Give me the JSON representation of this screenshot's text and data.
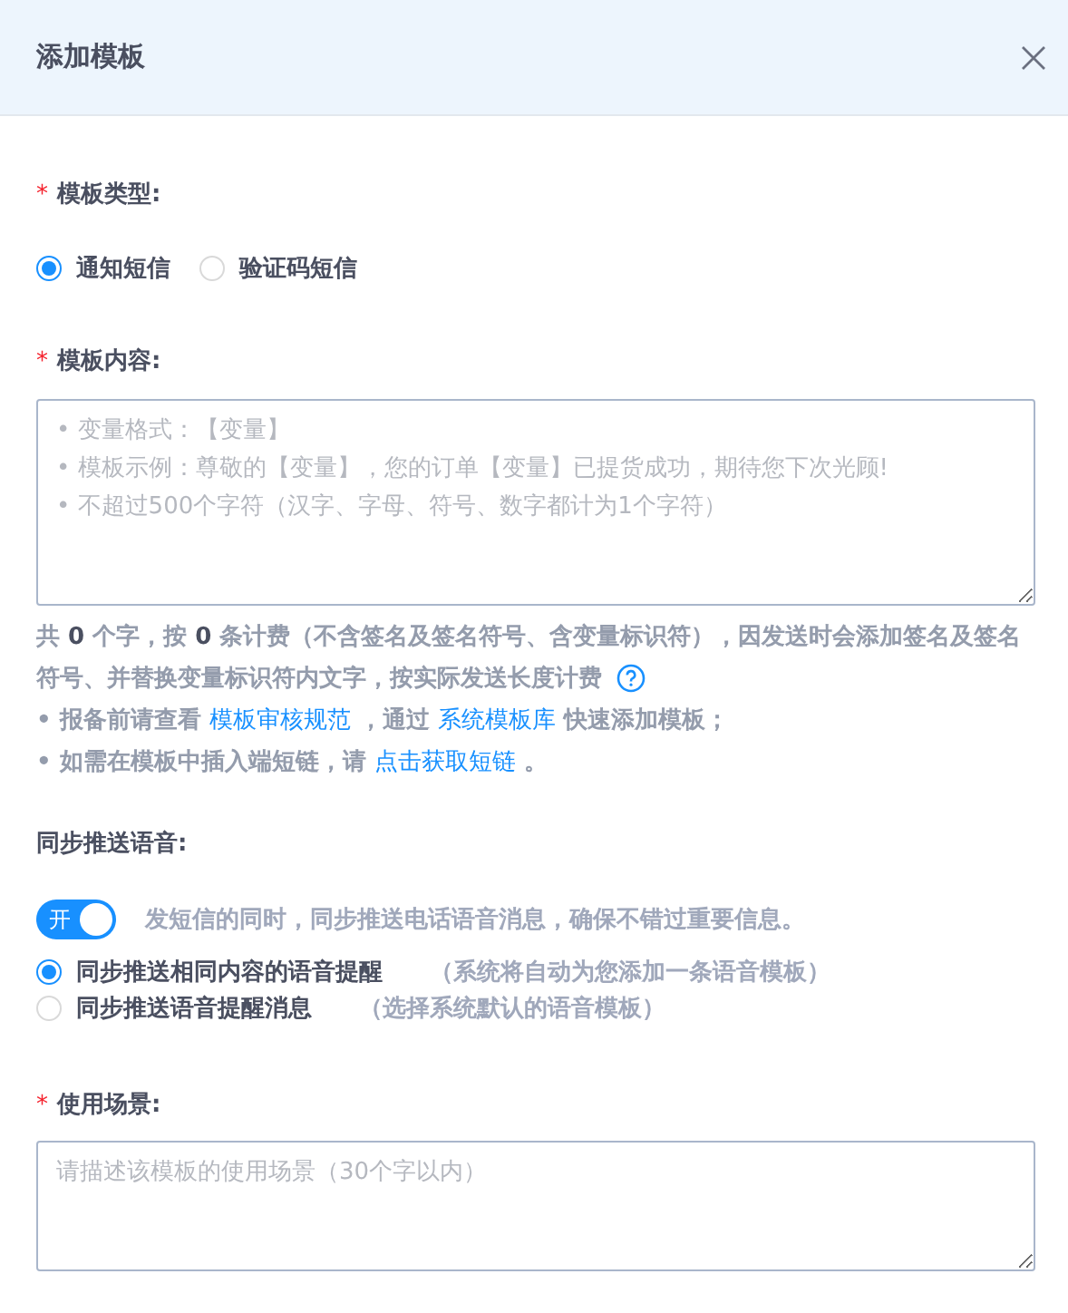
{
  "dialog": {
    "title": "添加模板"
  },
  "template_type": {
    "required_mark": "*",
    "label": "模板类型:",
    "options": [
      {
        "label": "通知短信",
        "selected": true
      },
      {
        "label": "验证码短信",
        "selected": false
      }
    ]
  },
  "template_content": {
    "required_mark": "*",
    "label": "模板内容:",
    "placeholder_lines": [
      "• 变量格式：【变量】",
      "• 模板示例：尊敬的【变量】，您的订单【变量】已提货成功，期待您下次光顾!",
      "• 不超过500个字符（汉字、字母、符号、数字都计为1个字符）"
    ]
  },
  "count_note": "共 **0** 个字，按 **0** 条计费（不含签名及签名符号、含变量标识符），因发送时会添加签名及签名符号、并替换变量标识符内文字，按实际发送长度计费",
  "tips": [
    [
      {
        "kind": "text",
        "text": "• 报备前请查看 "
      },
      {
        "kind": "link",
        "text": "模板审核规范"
      },
      {
        "kind": "text",
        "text": " ，通过 "
      },
      {
        "kind": "link",
        "text": "系统模板库"
      },
      {
        "kind": "text",
        "text": " 快速添加模板；"
      }
    ],
    [
      {
        "kind": "text",
        "text": "• 如需在模板中插入端短链，请 "
      },
      {
        "kind": "link",
        "text": "点击获取短链"
      },
      {
        "kind": "text",
        "text": " 。"
      }
    ]
  ],
  "voice": {
    "label": "同步推送语音:",
    "switch": {
      "label": "开",
      "on": true
    },
    "description": "发短信的同时，同步推送电话语音消息，确保不错过重要信息。",
    "options": [
      {
        "label": "同步推送相同内容的语音提醒",
        "hint": "（系统将自动为您添加一条语音模板）",
        "selected": true
      },
      {
        "label": "同步推送语音提醒消息",
        "hint": "（选择系统默认的语音模板）",
        "selected": false
      }
    ]
  },
  "scenario": {
    "required_mark": "*",
    "label": "使用场景:",
    "placeholder": "请描述该模板的使用场景（30个字以内）"
  }
}
